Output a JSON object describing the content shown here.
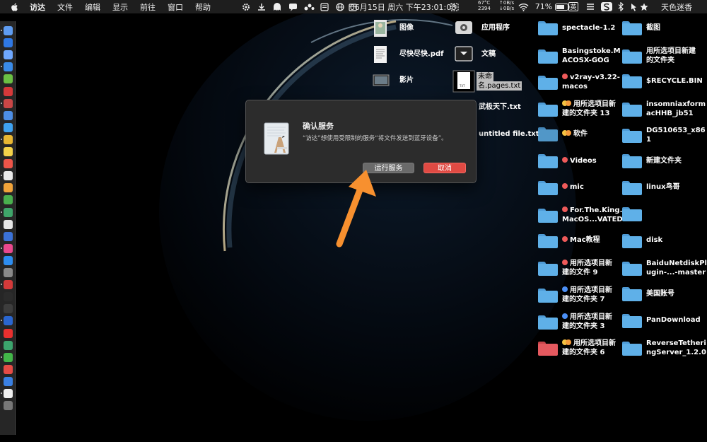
{
  "menubar": {
    "app_name": "访达",
    "items": [
      "文件",
      "编辑",
      "显示",
      "前往",
      "窗口",
      "帮助"
    ],
    "temperature": "67°C",
    "fan": "2394",
    "net_up": "0B/s",
    "net_down": "0B/s",
    "clock": "06月15日 周六 下午23:01:08",
    "battery": "71%",
    "input_method": "英",
    "user": "天色迷香"
  },
  "dock": {
    "icons": [
      "finder",
      "siri",
      "launchpad",
      "safari",
      "android",
      "netease-music",
      "bear",
      "mail",
      "qq-browser",
      "chrome",
      "notes",
      "calendar",
      "file",
      "photos",
      "facetime",
      "wechat-web",
      "notes-pad",
      "keynote",
      "itunes",
      "app-store",
      "preferences",
      "vivaldi",
      "terminal",
      "activity",
      "vpn",
      "yandex",
      "qr",
      "wechat",
      "netease",
      "appstore-blue",
      "file2",
      "trash"
    ]
  },
  "desktop": {
    "col1": [
      {
        "label": "图像",
        "icon": "image-file"
      },
      {
        "label": "尽快尽快.pdf",
        "icon": "pdf-file"
      },
      {
        "label": "影片",
        "icon": "movie-file"
      }
    ],
    "col2": [
      {
        "label": "应用程序",
        "icon": "applications-disk"
      },
      {
        "label": "文稿",
        "icon": "documents-folder"
      },
      {
        "label": "未命名.pages.txt",
        "line1": "未命",
        "line2": "名.pages.txt",
        "icon": "txt-file"
      },
      {
        "label": "武极天下.txt",
        "icon": "txt-file"
      },
      {
        "label": "untitled file.txt",
        "icon": "txt-file"
      }
    ],
    "col3": [
      {
        "line1": "spectacle-1.2",
        "line2": "",
        "tags": []
      },
      {
        "line1": "Basingstoke.M",
        "line2": "ACOSX-GOG",
        "tags": []
      },
      {
        "line1": "v2ray-v3.22-",
        "line2": "macos",
        "tags": [
          "r"
        ]
      },
      {
        "line1": "用所选项目新",
        "line2": "建的文件夹 13",
        "tags": [
          "y",
          "o"
        ]
      },
      {
        "line1": "软件",
        "line2": "",
        "tags": [
          "y",
          "o"
        ]
      },
      {
        "line1": "Videos",
        "line2": "",
        "tags": [
          "r"
        ]
      },
      {
        "line1": "mic",
        "line2": "",
        "tags": [
          "r"
        ]
      },
      {
        "line1": "For.The.King.",
        "line2": "MacOS...VATED",
        "tags": [
          "r"
        ]
      },
      {
        "line1": "Mac教程",
        "line2": "",
        "tags": [
          "r"
        ]
      },
      {
        "line1": "用所选项目新",
        "line2": "建的文件 9",
        "tags": [
          "r"
        ]
      },
      {
        "line1": "用所选项目新",
        "line2": "建的文件夹 7",
        "tags": [
          "b"
        ]
      },
      {
        "line1": "用所选项目新",
        "line2": "建的文件夹 3",
        "tags": [
          "b"
        ]
      },
      {
        "line1": "用所选项目新",
        "line2": "建的文件夹 6",
        "tags": [
          "y",
          "o"
        ]
      }
    ],
    "col4": [
      {
        "line1": "截图",
        "line2": ""
      },
      {
        "line1": "用所选项目新建",
        "line2": "的文件夹"
      },
      {
        "line1": "$RECYCLE.BIN",
        "line2": ""
      },
      {
        "line1": "insomniaxform",
        "line2": "acHHB_jb51"
      },
      {
        "line1": "DG510653_x86",
        "line2": "1"
      },
      {
        "line1": "新建文件夹",
        "line2": ""
      },
      {
        "line1": "linux鸟哥",
        "line2": ""
      },
      {
        "line1": "",
        "line2": ""
      },
      {
        "line1": "disk",
        "line2": ""
      },
      {
        "line1": "BaiduNetdiskPl",
        "line2": "ugin-...-master"
      },
      {
        "line1": "美国账号",
        "line2": ""
      },
      {
        "line1": "PanDownload",
        "line2": ""
      },
      {
        "line1": "ReverseTetheri",
        "line2": "ngServer_1.2.0"
      }
    ]
  },
  "dialog": {
    "title": "确认服务",
    "message": "“访达”想使用受限制的服务“将文件发送到蓝牙设备”。",
    "run_label": "运行服务",
    "cancel_label": "取消"
  },
  "colors": {
    "menubar_bg": "#1e1e1e",
    "folder_blue": "#5fb0e8",
    "folder_red": "#e5595f",
    "dialog_bg": "#2c2c2c",
    "cancel_red": "#e04a43",
    "arrow_orange": "#f7902f"
  }
}
